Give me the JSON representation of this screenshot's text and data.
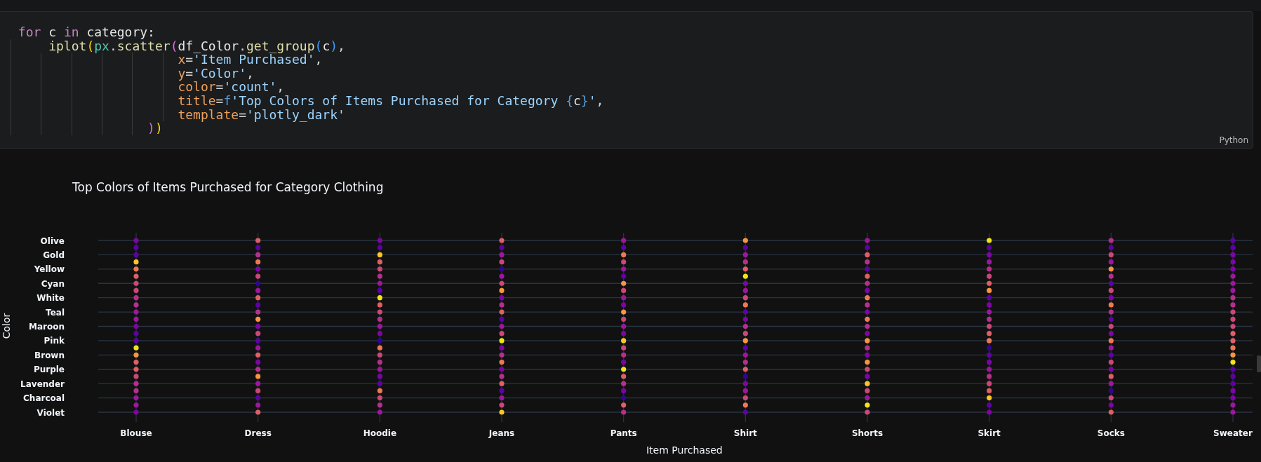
{
  "code_cell": {
    "language": "Python",
    "lines": [
      [
        {
          "text": "for",
          "kind": "keyword"
        },
        {
          "text": " c ",
          "kind": "variable"
        },
        {
          "text": "in",
          "kind": "keyword"
        },
        {
          "text": " category:",
          "kind": "variable"
        }
      ],
      [
        {
          "text": "    iplot",
          "kind": "function"
        },
        {
          "text": "(",
          "kind": "paren1"
        },
        {
          "text": "px",
          "kind": "module"
        },
        {
          "text": ".",
          "kind": "plain"
        },
        {
          "text": "scatter",
          "kind": "function"
        },
        {
          "text": "(",
          "kind": "paren2"
        },
        {
          "text": "df_Color",
          "kind": "variable"
        },
        {
          "text": ".",
          "kind": "plain"
        },
        {
          "text": "get_group",
          "kind": "function"
        },
        {
          "text": "(",
          "kind": "paren3"
        },
        {
          "text": "c",
          "kind": "variable"
        },
        {
          "text": ")",
          "kind": "paren3"
        },
        {
          "text": ",",
          "kind": "plain"
        }
      ],
      [
        {
          "text": "                     x",
          "kind": "param"
        },
        {
          "text": "=",
          "kind": "plain"
        },
        {
          "text": "'Item Purchased'",
          "kind": "string"
        },
        {
          "text": ",",
          "kind": "plain"
        }
      ],
      [
        {
          "text": "                     y",
          "kind": "param"
        },
        {
          "text": "=",
          "kind": "plain"
        },
        {
          "text": "'Color'",
          "kind": "string"
        },
        {
          "text": ",",
          "kind": "plain"
        }
      ],
      [
        {
          "text": "                     color",
          "kind": "param"
        },
        {
          "text": "=",
          "kind": "plain"
        },
        {
          "text": "'count'",
          "kind": "string"
        },
        {
          "text": ",",
          "kind": "plain"
        }
      ],
      [
        {
          "text": "                     title",
          "kind": "param"
        },
        {
          "text": "=",
          "kind": "plain"
        },
        {
          "text": "f",
          "kind": "keyword2"
        },
        {
          "text": "'Top Colors of Items Purchased for Category ",
          "kind": "string"
        },
        {
          "text": "{",
          "kind": "brace"
        },
        {
          "text": "c",
          "kind": "variable"
        },
        {
          "text": "}",
          "kind": "brace"
        },
        {
          "text": "'",
          "kind": "string"
        },
        {
          "text": ",",
          "kind": "plain"
        }
      ],
      [
        {
          "text": "                     template",
          "kind": "param"
        },
        {
          "text": "=",
          "kind": "plain"
        },
        {
          "text": "'plotly_dark'",
          "kind": "string"
        }
      ],
      [
        {
          "text": "                 )",
          "kind": "paren2"
        },
        {
          "text": ")",
          "kind": "paren1"
        }
      ]
    ]
  },
  "output": {
    "plot": {
      "title": "Top Colors of Items Purchased for Category Clothing",
      "x_axis_title": "Item Purchased",
      "y_axis_title": "Color",
      "x_labels": [
        "Blouse",
        "Dress",
        "Hoodie",
        "Jeans",
        "Pants",
        "Shirt",
        "Shorts",
        "Skirt",
        "Socks",
        "Sweater"
      ],
      "y_labels": [
        "Olive",
        "Gold",
        "Yellow",
        "Cyan",
        "White",
        "Teal",
        "Maroon",
        "Pink",
        "Brown",
        "Purple",
        "Lavender",
        "Charcoal",
        "Violet"
      ]
    }
  }
}
